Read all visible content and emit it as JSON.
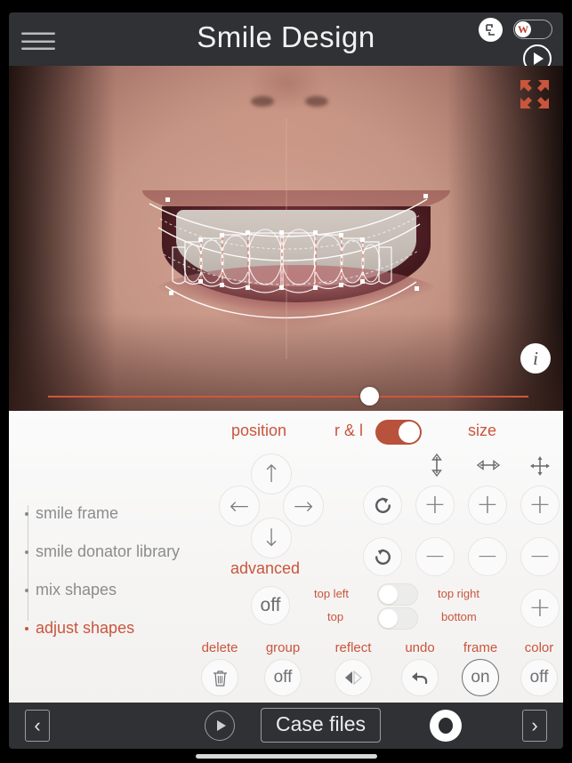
{
  "header": {
    "title": "Smile Design",
    "menu_icon": "hamburger-icon",
    "screen_rotate_icon": "screen-rotate-icon",
    "w_toggle_label": "W",
    "play_icon": "play-icon"
  },
  "image_area": {
    "fit_icon": "collapse-arrows-icon",
    "info_label": "i",
    "slider_value": "65"
  },
  "panel": {
    "sections": {
      "position_label": "position",
      "rl_label": "r & l",
      "rl_toggle_state": "on",
      "size_label": "size",
      "advanced_label": "advanced",
      "advanced_state": "off"
    },
    "sidebar": {
      "items": [
        {
          "label": "smile frame",
          "active": false
        },
        {
          "label": "smile donator library",
          "active": false
        },
        {
          "label": "mix shapes",
          "active": false
        },
        {
          "label": "adjust shapes",
          "active": true
        }
      ]
    },
    "dpad": {
      "up": "↑",
      "down": "↓",
      "left": "←",
      "right": "→"
    },
    "rotate": {
      "clockwise_icon": "rotate-clockwise-icon",
      "counterclockwise_icon": "rotate-counterclockwise-icon"
    },
    "size_columns": [
      {
        "icon_name": "vertical-resize-icon",
        "glyph": "⇕",
        "plus": "+",
        "minus": "−"
      },
      {
        "icon_name": "horizontal-resize-icon",
        "glyph": "⇔",
        "plus": "+",
        "minus": "−"
      },
      {
        "icon_name": "uniform-resize-icon",
        "glyph": "✜",
        "plus": "+",
        "minus": "−"
      }
    ],
    "advanced_toggles": [
      {
        "left_label": "top left",
        "right_label": "top right",
        "state": "off"
      },
      {
        "left_label": "top",
        "right_label": "bottom",
        "state": "off"
      }
    ],
    "extra_plus": "+",
    "actions": [
      {
        "label": "delete",
        "value": "",
        "icon_name": "trash-icon",
        "active": false
      },
      {
        "label": "group",
        "value": "off",
        "icon_name": "group-toggle",
        "active": false
      },
      {
        "label": "reflect",
        "value": "",
        "icon_name": "reflect-icon",
        "active": false
      },
      {
        "label": "undo",
        "value": "",
        "icon_name": "undo-arrow-icon",
        "active": false
      },
      {
        "label": "frame",
        "value": "on",
        "icon_name": "frame-toggle",
        "active": true
      },
      {
        "label": "color",
        "value": "off",
        "icon_name": "color-toggle",
        "active": false
      }
    ]
  },
  "bottom_bar": {
    "prev_label": "‹",
    "next_label": "›",
    "play_icon": "play-outline-icon",
    "case_files_label": "Case files",
    "record_icon": "record-icon"
  },
  "colors": {
    "accent": "#c9553c",
    "toggle_on": "#b8523c",
    "bar_bg": "#2f3134",
    "panel_bg": "#f7f6f5"
  }
}
